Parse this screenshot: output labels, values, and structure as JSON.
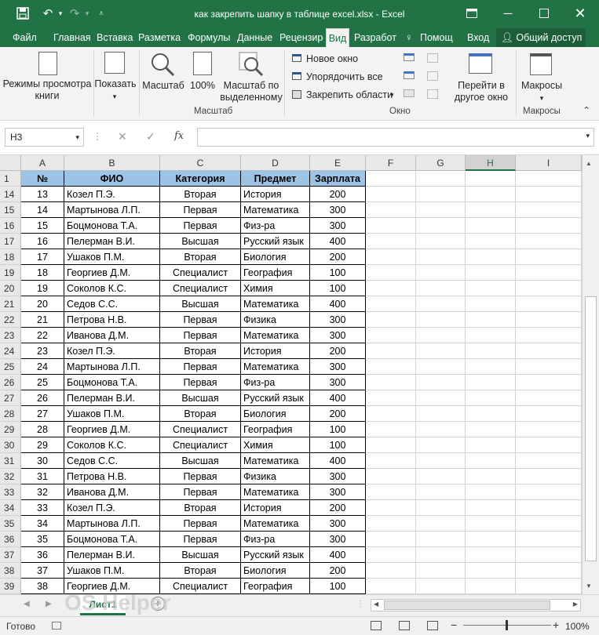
{
  "window": {
    "title": "как закрепить шапку в таблице excel.xlsx - Excel",
    "save_icon": "save-icon",
    "undo_icon": "undo-icon",
    "redo_icon": "redo-icon",
    "qat_icon": "customize-qat-icon"
  },
  "tabs": [
    "Файл",
    "Главная",
    "Вставка",
    "Разметка с",
    "Формулы",
    "Данные",
    "Рецензиро",
    "Вид",
    "Разработ",
    "Помощ",
    "Вход"
  ],
  "share_label": "Общий доступ",
  "ribbon": {
    "views_label": "Режимы просмотра книги",
    "show_label": "Показать",
    "zoom_label": "Масштаб",
    "zoom100_label": "100%",
    "zoomsel_label": "Масштаб по выделенному",
    "zoom_group": "Масштаб",
    "new_window": "Новое окно",
    "arrange_all": "Упорядочить все",
    "freeze_panes": "Закрепить области",
    "window_group": "Окно",
    "switch_windows": "Перейти в другое окно",
    "macros_label": "Макросы",
    "macros_group": "Макросы"
  },
  "formula_bar": {
    "namebox": "H3",
    "fx": "fx",
    "value": ""
  },
  "columns": [
    "A",
    "B",
    "C",
    "D",
    "E",
    "F",
    "G",
    "H",
    "I"
  ],
  "selected_column": "H",
  "header_row": {
    "row": "1",
    "cells": [
      "№",
      "ФИО",
      "Категория",
      "Предмет",
      "Зарплата"
    ]
  },
  "rows": [
    {
      "r": "14",
      "n": "13",
      "name": "Козел П.Э.",
      "cat": "Вторая",
      "subj": "История",
      "sal": "200"
    },
    {
      "r": "15",
      "n": "14",
      "name": "Мартынова Л.П.",
      "cat": "Первая",
      "subj": "Математика",
      "sal": "300"
    },
    {
      "r": "16",
      "n": "15",
      "name": "Боцмонова Т.А.",
      "cat": "Первая",
      "subj": "Физ-ра",
      "sal": "300"
    },
    {
      "r": "17",
      "n": "16",
      "name": "Пелерман В.И.",
      "cat": "Высшая",
      "subj": "Русский язык",
      "sal": "400"
    },
    {
      "r": "18",
      "n": "17",
      "name": "Ушаков П.М.",
      "cat": "Вторая",
      "subj": "Биология",
      "sal": "200"
    },
    {
      "r": "19",
      "n": "18",
      "name": "Георгиев Д.М.",
      "cat": "Специалист",
      "subj": "География",
      "sal": "100"
    },
    {
      "r": "20",
      "n": "19",
      "name": "Соколов К.С.",
      "cat": "Специалист",
      "subj": "Химия",
      "sal": "100"
    },
    {
      "r": "21",
      "n": "20",
      "name": "Седов С.С.",
      "cat": "Высшая",
      "subj": "Математика",
      "sal": "400"
    },
    {
      "r": "22",
      "n": "21",
      "name": "Петрова Н.В.",
      "cat": "Первая",
      "subj": "Физика",
      "sal": "300"
    },
    {
      "r": "23",
      "n": "22",
      "name": "Иванова Д.М.",
      "cat": "Первая",
      "subj": "Математика",
      "sal": "300"
    },
    {
      "r": "24",
      "n": "23",
      "name": "Козел П.Э.",
      "cat": "Вторая",
      "subj": "История",
      "sal": "200"
    },
    {
      "r": "25",
      "n": "24",
      "name": "Мартынова Л.П.",
      "cat": "Первая",
      "subj": "Математика",
      "sal": "300"
    },
    {
      "r": "26",
      "n": "25",
      "name": "Боцмонова Т.А.",
      "cat": "Первая",
      "subj": "Физ-ра",
      "sal": "300"
    },
    {
      "r": "27",
      "n": "26",
      "name": "Пелерман В.И.",
      "cat": "Высшая",
      "subj": "Русский язык",
      "sal": "400"
    },
    {
      "r": "28",
      "n": "27",
      "name": "Ушаков П.М.",
      "cat": "Вторая",
      "subj": "Биология",
      "sal": "200"
    },
    {
      "r": "29",
      "n": "28",
      "name": "Георгиев Д.М.",
      "cat": "Специалист",
      "subj": "География",
      "sal": "100"
    },
    {
      "r": "30",
      "n": "29",
      "name": "Соколов К.С.",
      "cat": "Специалист",
      "subj": "Химия",
      "sal": "100"
    },
    {
      "r": "31",
      "n": "30",
      "name": "Седов С.С.",
      "cat": "Высшая",
      "subj": "Математика",
      "sal": "400"
    },
    {
      "r": "32",
      "n": "31",
      "name": "Петрова Н.В.",
      "cat": "Первая",
      "subj": "Физика",
      "sal": "300"
    },
    {
      "r": "33",
      "n": "32",
      "name": "Иванова Д.М.",
      "cat": "Первая",
      "subj": "Математика",
      "sal": "300"
    },
    {
      "r": "34",
      "n": "33",
      "name": "Козел П.Э.",
      "cat": "Вторая",
      "subj": "История",
      "sal": "200"
    },
    {
      "r": "35",
      "n": "34",
      "name": "Мартынова Л.П.",
      "cat": "Первая",
      "subj": "Математика",
      "sal": "300"
    },
    {
      "r": "36",
      "n": "35",
      "name": "Боцмонова Т.А.",
      "cat": "Первая",
      "subj": "Физ-ра",
      "sal": "300"
    },
    {
      "r": "37",
      "n": "36",
      "name": "Пелерман В.И.",
      "cat": "Высшая",
      "subj": "Русский язык",
      "sal": "400"
    },
    {
      "r": "38",
      "n": "37",
      "name": "Ушаков П.М.",
      "cat": "Вторая",
      "subj": "Биология",
      "sal": "200"
    },
    {
      "r": "39",
      "n": "38",
      "name": "Георгиев Д.М.",
      "cat": "Специалист",
      "subj": "География",
      "sal": "100"
    }
  ],
  "sheet_tab": "Лист1",
  "watermark": "OS Helper",
  "status": {
    "ready": "Готово",
    "zoom": "100%"
  },
  "colors": {
    "excel_green": "#217346",
    "header_fill": "#9dc3e6"
  }
}
